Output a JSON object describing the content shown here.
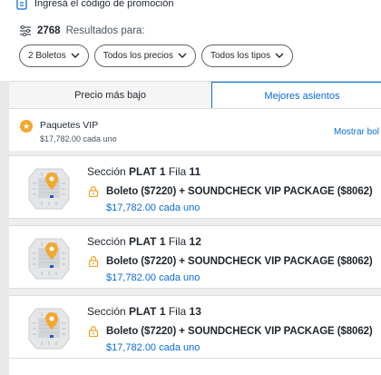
{
  "promo": {
    "text": "Ingresá el código de promoción"
  },
  "results": {
    "count": "2768",
    "label": "Resultados para:"
  },
  "filters": [
    {
      "label": "2 Boletos"
    },
    {
      "label": "Todos los precios"
    },
    {
      "label": "Todos los tipos"
    }
  ],
  "tabs": [
    {
      "label": "Precio más bajo",
      "active": false
    },
    {
      "label": "Mejores asientos",
      "active": true
    }
  ],
  "vip": {
    "title": "Paquetes VIP",
    "price": "$17,782.00 cada uno",
    "link": "Mostrar bol"
  },
  "listings": [
    {
      "sec_label": "Sección",
      "sec_value": "PLAT 1",
      "row_label": "Fila",
      "row_value": "11",
      "desc": "Boleto ($7220) + SOUNDCHECK VIP PACKAGE ($8062)",
      "price": "$17,782.00 cada uno"
    },
    {
      "sec_label": "Sección",
      "sec_value": "PLAT 1",
      "row_label": "Fila",
      "row_value": "12",
      "desc": "Boleto ($7220) + SOUNDCHECK VIP PACKAGE ($8062)",
      "price": "$17,782.00 cada uno"
    },
    {
      "sec_label": "Sección",
      "sec_value": "PLAT 1",
      "row_label": "Fila",
      "row_value": "13",
      "desc": "Boleto ($7220) + SOUNDCHECK VIP PACKAGE ($8062)",
      "price": "$17,782.00 cada uno"
    }
  ],
  "icons": {
    "promo": "coupon-icon",
    "results": "sliders-icon",
    "filter": "chevron-down-icon",
    "vip": "star-icon",
    "map": "venue-map-icon",
    "lock": "lock-icon",
    "pin": "location-pin-icon"
  },
  "colors": {
    "accent": "#0a6bd8",
    "star": "#f0a830",
    "lock": "#f0a830",
    "pin": "#f0a830",
    "text": "#1f262d"
  }
}
